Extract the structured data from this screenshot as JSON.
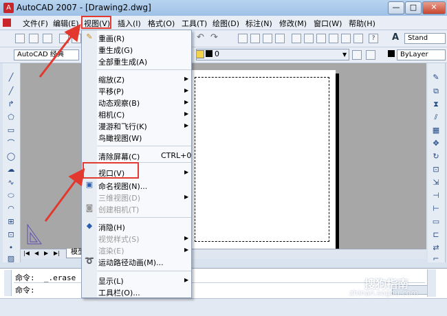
{
  "window": {
    "title": "AutoCAD 2007 - [Drawing2.dwg]",
    "app_icon": "autocad-icon",
    "controls": {
      "minimize": "—",
      "maximize": "□",
      "close": "✕"
    }
  },
  "menubar": {
    "items": [
      "文件(F)",
      "编辑(E)",
      "视图(V)",
      "插入(I)",
      "格式(O)",
      "工具(T)",
      "绘图(D)",
      "标注(N)",
      "修改(M)",
      "窗口(W)",
      "帮助(H)"
    ],
    "active": "视图(V)"
  },
  "toolbar": {
    "style_combo": "Stand",
    "workspace_combo": "AutoCAD 经典",
    "layer_value": "0",
    "linetype_combo": "ByLayer"
  },
  "view_menu": {
    "items": [
      {
        "label": "重画(R)",
        "icon": "redraw-icon"
      },
      {
        "label": "重生成(G)"
      },
      {
        "label": "全部重生成(A)"
      },
      {
        "label": "缩放(Z)",
        "submenu": true
      },
      {
        "label": "平移(P)",
        "submenu": true
      },
      {
        "label": "动态观察(B)",
        "submenu": true
      },
      {
        "label": "相机(C)",
        "submenu": true
      },
      {
        "label": "漫游和飞行(K)",
        "submenu": true
      },
      {
        "label": "鸟瞰视图(W)"
      },
      {
        "label": "清除屏幕(C)",
        "shortcut": "CTRL+0"
      },
      {
        "label": "视口(V)",
        "submenu": true
      },
      {
        "label": "命名视图(N)...",
        "icon": "named-view-icon"
      },
      {
        "label": "三维视图(D)",
        "submenu": true,
        "disabled": true
      },
      {
        "label": "创建相机(T)",
        "disabled": true,
        "icon": "camera-icon"
      },
      {
        "label": "消隐(H)",
        "icon": "hide-icon"
      },
      {
        "label": "视觉样式(S)",
        "submenu": true,
        "disabled": true
      },
      {
        "label": "渲染(E)",
        "submenu": true,
        "disabled": true
      },
      {
        "label": "运动路径动画(M)...",
        "icon": "motion-path-icon"
      },
      {
        "label": "显示(L)",
        "submenu": true
      },
      {
        "label": "工具栏(O)..."
      }
    ]
  },
  "drawing": {
    "tab_model": "模型"
  },
  "command_line": {
    "line1": "命令:  _.erase",
    "line2": "命令:"
  },
  "watermark": {
    "text": "搜狗指南",
    "url": "zhinan.sogou.com"
  },
  "highlight_color": "#e2382d"
}
